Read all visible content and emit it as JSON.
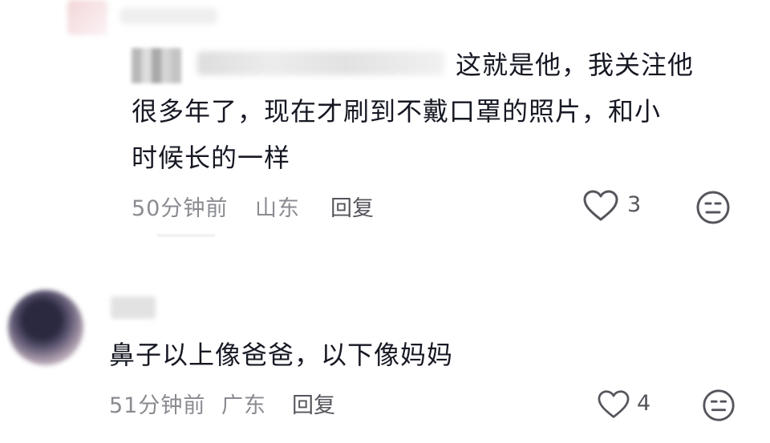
{
  "comments": [
    {
      "text_lines": [
        "这就是他，我关注他",
        "很多年了，现在才刷到不戴口罩的照片，和小",
        "时候长的一样"
      ],
      "time": "50分钟前",
      "location": "山东",
      "reply_label": "回复",
      "likes": "3"
    },
    {
      "text_lines": [
        "鼻子以上像爸爸，以下像妈妈"
      ],
      "time": "51分钟前",
      "location": "广东",
      "reply_label": "回复",
      "likes": "4"
    }
  ],
  "icons": {
    "like": "heart-outline-icon",
    "dislike": "meh-face-icon"
  }
}
